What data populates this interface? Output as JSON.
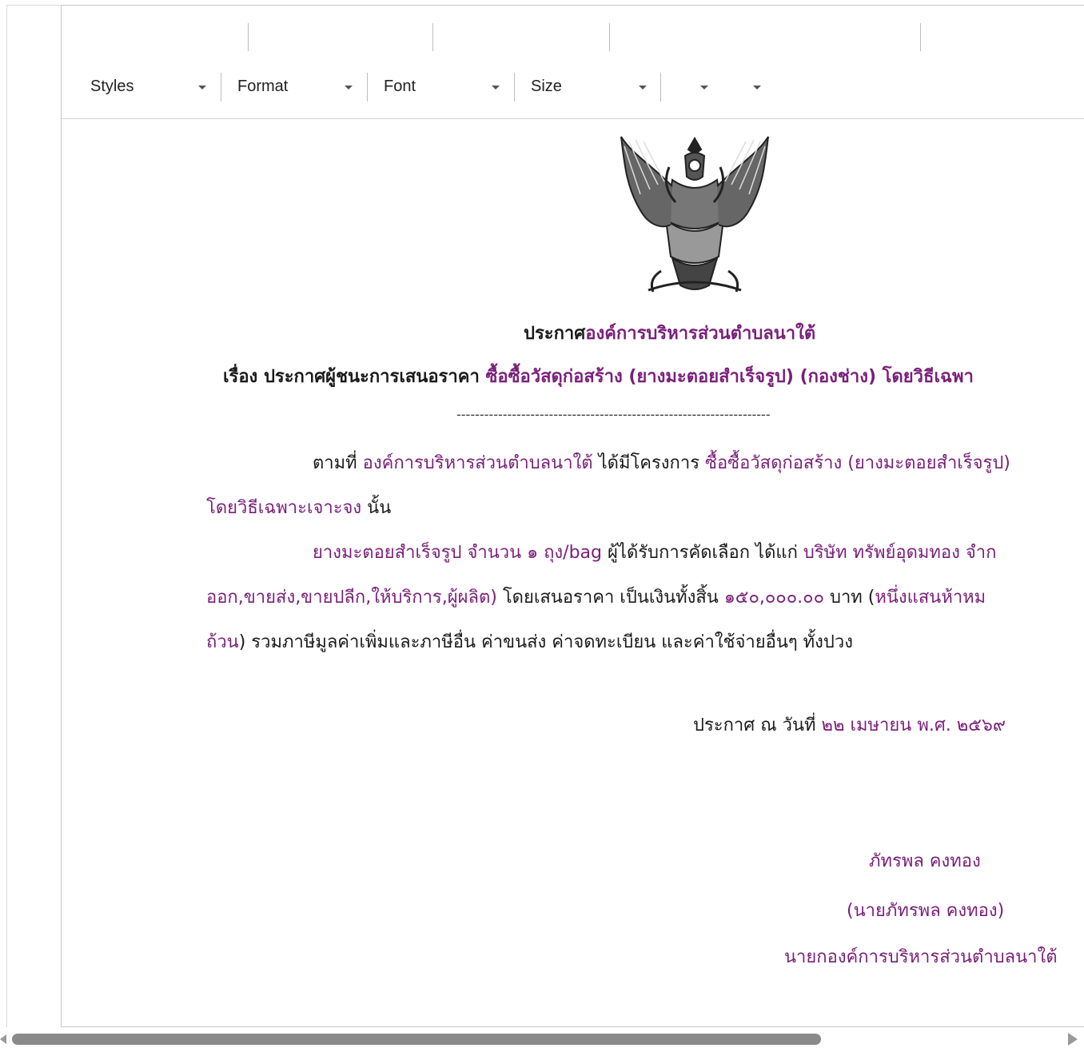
{
  "toolbar": {
    "styles_label": "Styles",
    "format_label": "Format",
    "font_label": "Font",
    "size_label": "Size",
    "color_label": "",
    "bg_label": ""
  },
  "document": {
    "title_prefix": "ประกาศ",
    "title_org": "องค์การบริหารส่วนตำบลนาใต้",
    "subject_prefix": "เรื่อง ประกาศผู้ชนะการเสนอราคา ",
    "subject_project": "ซื้อซื้อวัสดุก่อสร้าง (ยางมะตอยสำเร็จรูป) (กองช่าง) โดยวิธีเฉพา",
    "divider": "--------------------------------------------------------------------",
    "para1_a": "ตามที่ ",
    "para1_org": "องค์การบริหารส่วนตำบลนาใต้",
    "para1_b": " ได้มีโครงการ ",
    "para1_project": "ซื้อซื้อวัสดุก่อสร้าง (ยางมะตอยสำเร็จรูป)",
    "para1_method": "โดยวิธีเฉพาะเจาะจง",
    "para1_end": "  นั้น",
    "para2_item": "ยางมะตอยสำเร็จรูป จำนวน ๑ ถุง/bag",
    "para2_a": " ผู้ได้รับการคัดเลือก ได้แก่ ",
    "para2_company": "บริษัท ทรัพย์อุดมทอง จำก",
    "para2_company_cont": "ออก,ขายส่ง,ขายปลีก,ให้บริการ,ผู้ผลิต)",
    "para2_b": " โดยเสนอราคา เป็นเงินทั้งสิ้น ",
    "para2_amount": "๑๕๐,๐๐๐.๐๐",
    "para2_c": " บาท (",
    "para2_amount_text": "หนึ่งแสนห้าหม",
    "para2_amount_text_cont": "ถ้วน",
    "para2_d": ") รวมภาษีมูลค่าเพิ่มและภาษีอื่น ค่าขนส่ง ค่าจดทะเบียน และค่าใช้จ่ายอื่นๆ ทั้งปวง",
    "date_prefix": "ประกาศ ณ วันที่  ",
    "date_value": "๒๒ เมษายน พ.ศ. ๒๕๖๙",
    "signer_name": "ภัทรพล คงทอง",
    "signer_full": "(นายภัทรพล คงทอง)",
    "signer_position": "นายกองค์การบริหารส่วนตำบลนาใต้"
  },
  "colors": {
    "link_purple": "#7a1f7a",
    "text": "#1a1a1a"
  },
  "icons": {
    "emblem": "garuda-emblem-icon"
  }
}
